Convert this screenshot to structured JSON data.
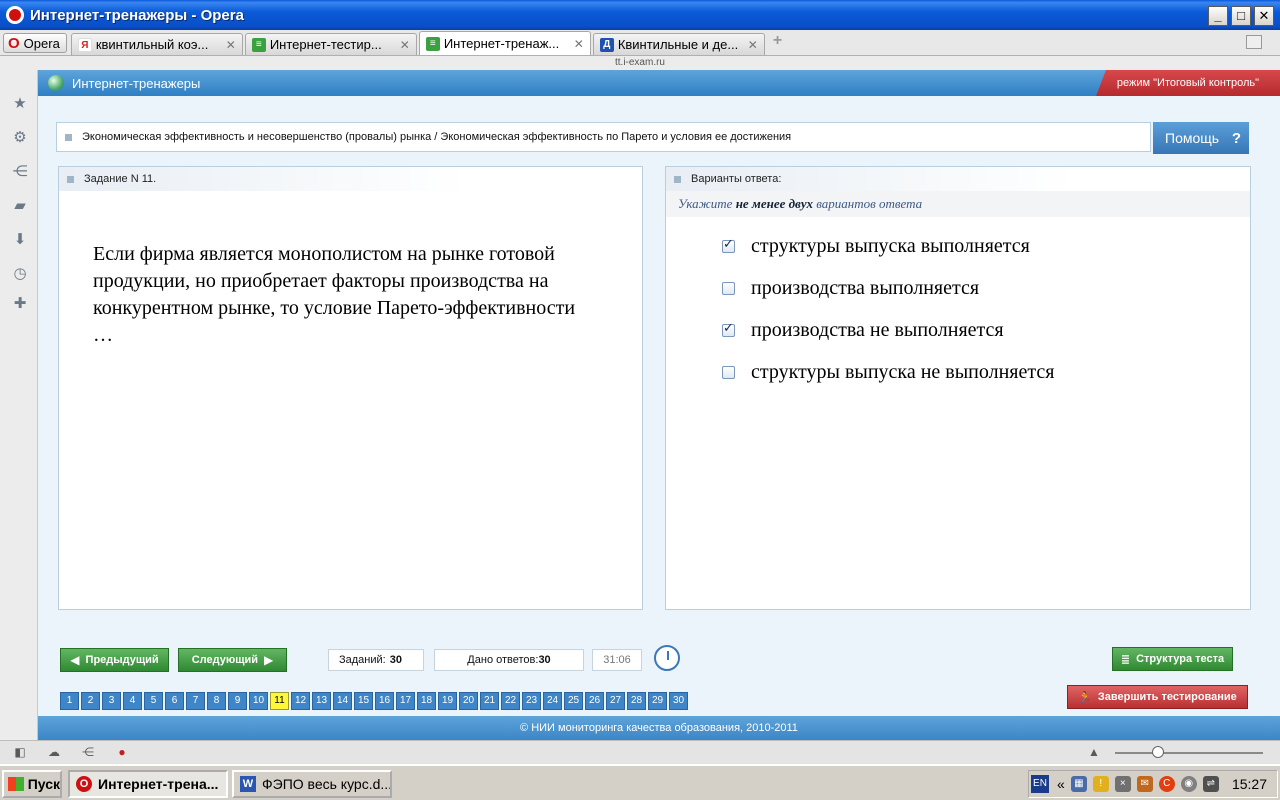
{
  "window": {
    "title": "Интернет-тренажеры - Opera",
    "minimize": "_",
    "maximize": "□",
    "close": "✕"
  },
  "browser": {
    "menu_label": "Opera",
    "tabs": [
      {
        "label": "квинтильный коэ...",
        "favicon": "Я",
        "favicon_color": "#d82020",
        "close": "✕"
      },
      {
        "label": "Интернет-тестир...",
        "favicon": "≡",
        "favicon_color": "#3aa040",
        "close": "✕"
      },
      {
        "label": "Интернет-тренаж...",
        "favicon": "≡",
        "favicon_color": "#3aa040",
        "close": "✕",
        "active": true
      },
      {
        "label": "Квинтильные и де...",
        "favicon": "Д",
        "favicon_color": "#2050b0",
        "close": "✕"
      }
    ],
    "new_tab": "+",
    "url": "tt.i-exam.ru"
  },
  "sidebar_icons": [
    "star-icon",
    "gear-icon",
    "share-icon",
    "notes-icon",
    "downloads-icon",
    "history-icon",
    "add-icon"
  ],
  "app": {
    "title": "Интернет-тренажеры",
    "mode": "режим \"Итоговый контроль\"",
    "topic": "Экономическая эффективность и несовершенство (провалы) рынка / Экономическая эффективность по Парето и условия ее достижения",
    "help_label": "Помощь",
    "help_symbol": "?"
  },
  "question": {
    "header": "Задание N 11.",
    "text": "Если фирма является монополистом на рынке готовой продукции, но приобретает факторы производства на конкурентном рынке, то условие Парето-эффективности …"
  },
  "answers": {
    "header": "Варианты ответа:",
    "instruction_prefix": "Укажите ",
    "instruction_bold": "не менее двух",
    "instruction_suffix": " вариантов ответа",
    "options": [
      {
        "label": "структуры выпуска выполняется",
        "checked": true
      },
      {
        "label": "производства выполняется",
        "checked": false
      },
      {
        "label": "производства не выполняется",
        "checked": true
      },
      {
        "label": "структуры выпуска не выполняется",
        "checked": false
      }
    ]
  },
  "controls": {
    "prev_label": "Предыдущий",
    "next_label": "Следующий",
    "tasks_label": "Заданий:",
    "tasks_count": "30",
    "answered_label": "Дано ответов:",
    "answered_count": "30",
    "timer": "31:06",
    "structure_label": "Структура теста",
    "finish_label": "Завершить тестирование"
  },
  "pagination": {
    "pages": [
      "1",
      "2",
      "3",
      "4",
      "5",
      "6",
      "7",
      "8",
      "9",
      "10",
      "11",
      "12",
      "13",
      "14",
      "15",
      "16",
      "17",
      "18",
      "19",
      "20",
      "21",
      "22",
      "23",
      "24",
      "25",
      "26",
      "27",
      "28",
      "29",
      "30"
    ],
    "current": "11"
  },
  "footer": "© НИИ мониторинга качества образования, 2010-2011",
  "taskbar": {
    "start": "Пуск",
    "tasks": [
      {
        "label": "Интернет-трена...",
        "active": true,
        "icon_color": "#d01010"
      },
      {
        "label": "ФЭПО весь курс.d...",
        "active": false,
        "icon_color": "#2a55b0"
      }
    ],
    "lang": "EN",
    "tray_chevron": "«",
    "time": "15:27"
  }
}
